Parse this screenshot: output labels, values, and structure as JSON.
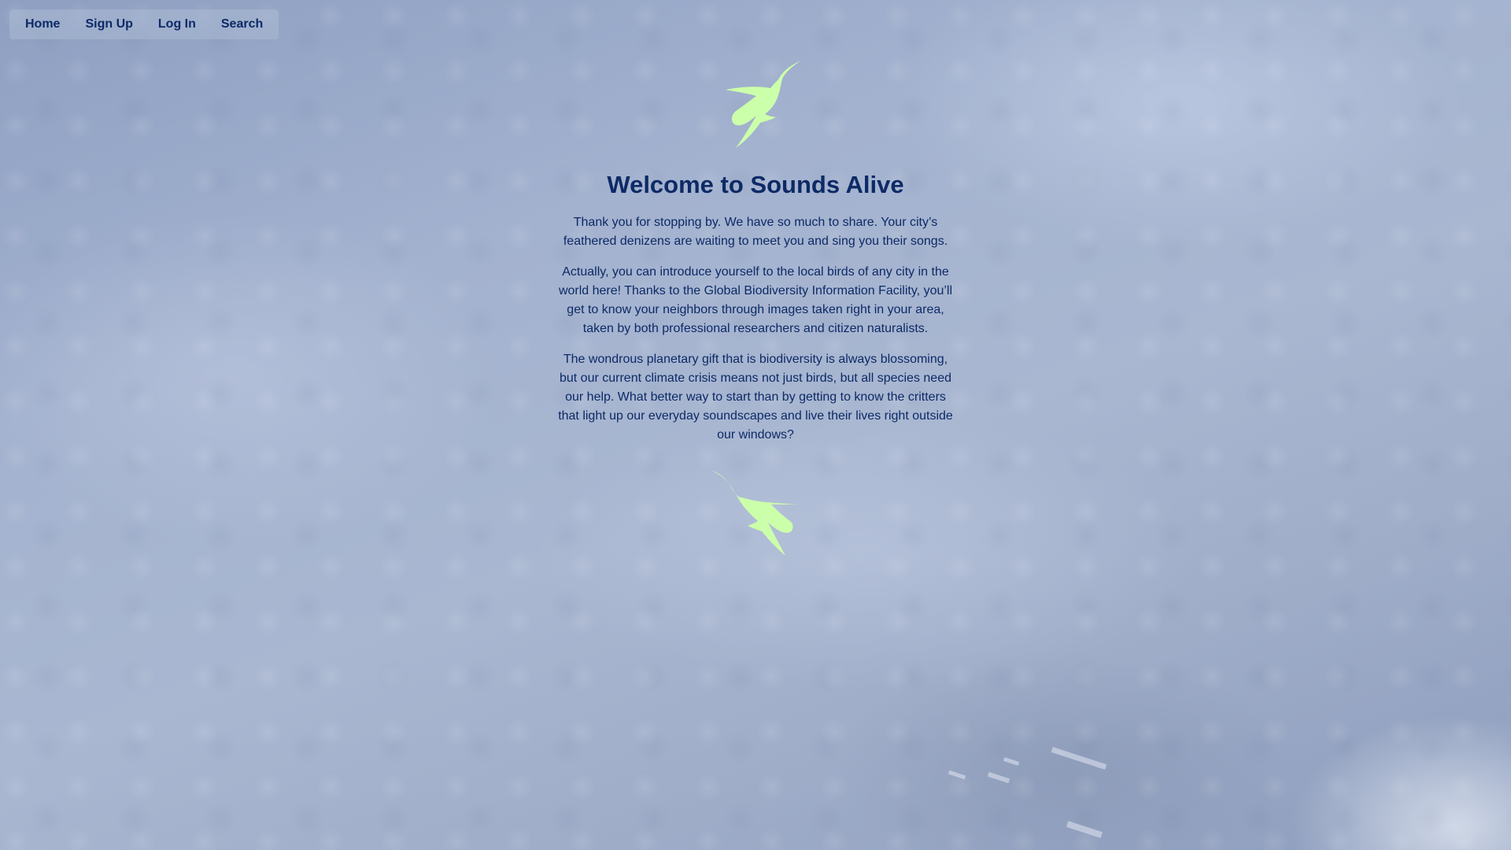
{
  "nav": {
    "items": [
      {
        "label": "Home"
      },
      {
        "label": "Sign Up"
      },
      {
        "label": "Log In"
      },
      {
        "label": "Search"
      }
    ]
  },
  "main": {
    "title": "Welcome to Sounds Alive",
    "paragraphs": [
      "Thank you for stopping by. We have so much to share. Your city’s feathered denizens are waiting to meet you and sing you their songs.",
      "Actually, you can introduce yourself to the local birds of any city in the world here! Thanks to the Global Biodiversity Information Facility, you’ll get to know your neighbors through images taken right in your area, taken by both professional researchers and citizen naturalists.",
      "The wondrous planetary gift that is biodiversity is always blossoming, but our current climate crisis means not just birds, but all species need our help. What better way to start than by getting to know the critters that light up our everyday soundscapes and live their lives right outside our windows?"
    ]
  },
  "decor": {
    "top_icon": "hummingbird-icon",
    "bottom_icon": "hummingbird-icon",
    "icon_color": "#ccffaa",
    "text_color": "#0d2a66",
    "background": "cloud-sky-photo"
  }
}
